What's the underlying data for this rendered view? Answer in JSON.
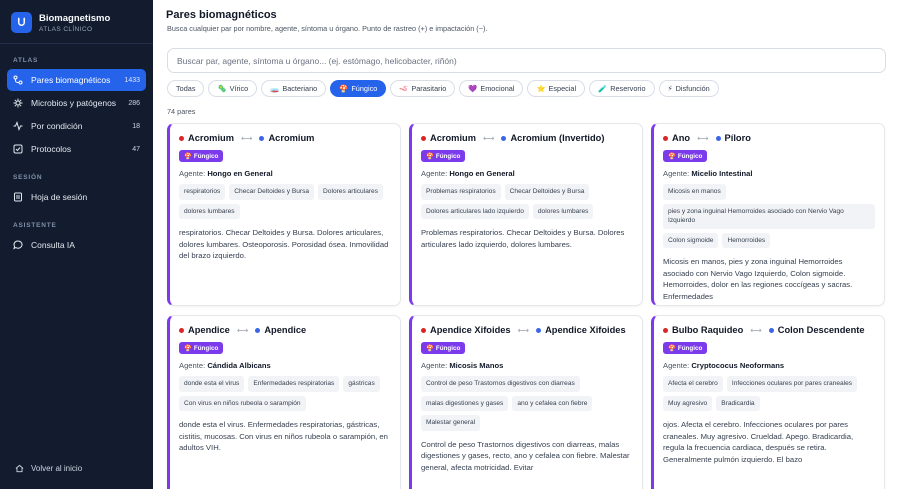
{
  "brand": {
    "title": "Biomagnetismo",
    "subtitle": "ATLAS CLÍNICO"
  },
  "sidebar": {
    "sections": [
      {
        "label": "ATLAS"
      },
      {
        "label": "SESIÓN"
      },
      {
        "label": "ASISTENTE"
      }
    ],
    "items": [
      {
        "label": "Pares biomagnéticos",
        "count": "1433",
        "icon": "magnet-icon",
        "active": true
      },
      {
        "label": "Microbios y patógenos",
        "count": "286",
        "icon": "microbe-icon"
      },
      {
        "label": "Por condición",
        "count": "18",
        "icon": "pulse-icon"
      },
      {
        "label": "Protocolos",
        "count": "47",
        "icon": "checklist-icon"
      },
      {
        "label": "Hoja de sesión",
        "count": "",
        "icon": "document-icon"
      },
      {
        "label": "Consulta IA",
        "count": "",
        "icon": "chat-icon"
      }
    ],
    "footer": "Volver al inicio"
  },
  "header": {
    "title": "Pares biomagnéticos",
    "subtitle": "Busca cualquier par por nombre, agente, síntoma u órgano. Punto de rastreo (+) e impactación (−)."
  },
  "search": {
    "placeholder": "Buscar par, agente, síntoma u órgano... (ej. estómago, helicobacter, riñón)",
    "value": ""
  },
  "filters": [
    {
      "label": "Todas",
      "icon": ""
    },
    {
      "label": "Vírico",
      "icon": "🦠"
    },
    {
      "label": "Bacteriano",
      "icon": "🧫"
    },
    {
      "label": "Fúngico",
      "icon": "🍄",
      "active": true
    },
    {
      "label": "Parasitario",
      "icon": "🪱"
    },
    {
      "label": "Emocional",
      "icon": "💜"
    },
    {
      "label": "Especial",
      "icon": "⭐"
    },
    {
      "label": "Reservorio",
      "icon": "🧪"
    },
    {
      "label": "Disfunción",
      "icon": "⚡"
    }
  ],
  "results_label": "74 pares",
  "agent_prefix": "Agente:",
  "cards": [
    {
      "point_a": "Acromium",
      "point_b": "Acromium",
      "badge": "Fúngico",
      "agent": "Hongo en General",
      "tags": [
        "respiratorios",
        "Checar Deltoides y Bursa",
        "Dolores articulares",
        "dolores lumbares"
      ],
      "description": "respiratorios. Checar Deltoides y Bursa. Dolores articulares, dolores lumbares. Osteoporosis. Porosidad ósea. Inmovilidad del brazo izquierdo."
    },
    {
      "point_a": "Acromium",
      "point_b": "Acromium (Invertido)",
      "badge": "Fúngico",
      "agent": "Hongo en General",
      "tags": [
        "Problemas respiratorios",
        "Checar Deltoides y Bursa",
        "Dolores articulares lado izquierdo",
        "dolores lumbares"
      ],
      "description": "Problemas respiratorios. Checar Deltoides y Bursa. Dolores articulares lado izquierdo, dolores lumbares."
    },
    {
      "point_a": "Ano",
      "point_b": "Píloro",
      "badge": "Fúngico",
      "agent": "Micelio Intestinal",
      "tags": [
        "Micosis en manos",
        "pies y zona inguinal Hemorroides asociado con Nervio Vago Izquierdo",
        "Colon sigmoide",
        "Hemorroides"
      ],
      "description": "Micosis en manos, pies y zona inguinal Hemorroides asociado con Nervio Vago Izquierdo, Colon sigmoide. Hemorroides, dolor en las regiones coccígeas y sacras. Enfermedades"
    },
    {
      "point_a": "Apendice",
      "point_b": "Apendice",
      "badge": "Fúngico",
      "agent": "Cándida Albicans",
      "tags": [
        "donde esta el virus",
        "Enfermedades respiratorias",
        "gástricas",
        "Con virus en niños rubeola o sarampión"
      ],
      "description": "donde esta el virus. Enfermedades respiratorias, gástricas, cistitis, mucosas. Con virus en niños rubeola o sarampión, en adultos VIH."
    },
    {
      "point_a": "Apendice Xifoides",
      "point_b": "Apendice Xifoides",
      "badge": "Fúngico",
      "agent": "Micosis Manos",
      "tags": [
        "Control de peso Trastornos digestivos con diarreas",
        "malas digestiones y gases",
        "ano y cefalea con fiebre",
        "Malestar general"
      ],
      "description": "Control de peso Trastornos digestivos con diarreas, malas digestiones y gases, recto, ano y cefalea con fiebre. Malestar general, afecta motricidad. Evitar"
    },
    {
      "point_a": "Bulbo Raquideo",
      "point_b": "Colon Descendente",
      "badge": "Fúngico",
      "agent": "Cryptococus Neoformans",
      "tags": [
        "Afecta el cerebro",
        "Infecciones oculares por pares craneales",
        "Muy agresivo",
        "Bradicardia"
      ],
      "description": "ojos. Afecta el cerebro. Infecciones oculares por pares craneales. Muy agresivo. Crueldad. Apego. Bradicardia, regula la frecuencia cardiaca, después se retira. Generalmente pulmón izquierdo. El bazo"
    }
  ]
}
